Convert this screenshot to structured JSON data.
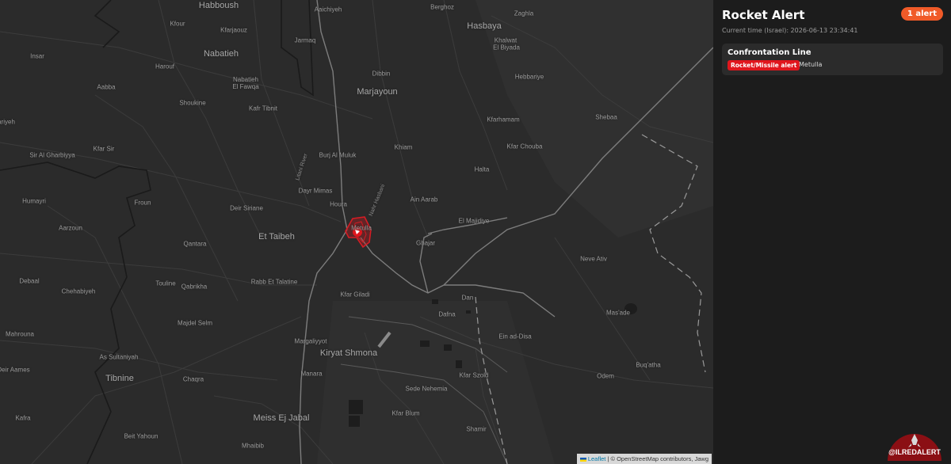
{
  "panel": {
    "title": "Rocket Alert",
    "alert_count": "1 alert",
    "current_time": "Current time (Israel): 2026-06-13 23:34:41",
    "alerts": [
      {
        "region": "Confrontation Line",
        "type": "Rocket/Missile alert",
        "city": "Metulla"
      }
    ],
    "logo_text": "@ILREDALERT"
  },
  "map": {
    "labels": {
      "habboush": "Habboush",
      "aaichiyeh": "Aaichiyeh",
      "berghoz": "Berghoz",
      "zaghla": "Zaghla",
      "hasbaya": "Hasbaya",
      "kfour": "Kfour",
      "kfarjaouz": "Kfarjaouz",
      "jarmaq": "Jarmaq",
      "khalwat": "Khalwat",
      "el_biyada": "El Biyada",
      "insar": "Insar",
      "nabatieh": "Nabatieh",
      "harouf": "Harouf",
      "dibbin": "Dibbin",
      "hebbariye": "Hebbariye",
      "aabba": "Aabba",
      "nabatieh_fawqa": "Nabatieh\nEl Fawqa",
      "marjayoun": "Marjayoun",
      "shoukine": "Shoukine",
      "kafr_tibnit": "Kafr Tibnit",
      "shebaa": "Shebaa",
      "kfarhamam": "Kfarhamam",
      "ariyeh": "ariyeh",
      "kfar_sir": "Kfar Sir",
      "khiam": "Khiam",
      "kfar_chouba": "Kfar Chouba",
      "sir_al_gharbiyya": "Sir Al Gharbiyya",
      "burj_al_muluk": "Burj Al Muluk",
      "halta": "Halta",
      "litani": "Litani River",
      "dayr_mimas": "Dayr Mimas",
      "nahr": "Nahr Hasbani",
      "humayri": "Humayri",
      "froun": "Froun",
      "houra": "Houra",
      "ain_aarab": "Ain Aarab",
      "deir_siriane": "Deir Siriane",
      "el_majidiye": "El Majidiye",
      "aarzoun": "Aarzoun",
      "metulla": "Metulla",
      "et_taibeh": "Et Taibeh",
      "ghajar": "Ghajar",
      "qantara": "Qantara",
      "neve_ativ": "Neve Ativ",
      "debaal": "Debaal",
      "rabb_talatine": "Rabb Et Talatine",
      "touline": "Touline",
      "qabrikha": "Qabrikha",
      "chehabiyeh": "Chehabiyeh",
      "kfar_giladi": "Kfar Giladi",
      "dan": "Dan",
      "masade": "Mas'ade",
      "dafna": "Dafna",
      "majdel_selm": "Majdel Selm",
      "mahrouna": "Mahrouna",
      "margaliyyot": "Margaliyyot",
      "ein_ad_disa": "Ein ad-Disa",
      "as_sultaniyah": "As Sultaniyah",
      "kiryat_shmona": "Kiryat Shmona",
      "deir_aames": "Deir Aames",
      "tibnine": "Tibnine",
      "manara": "Manara",
      "kfar_szold": "Kfar Szold",
      "odem": "Odem",
      "buq_atha": "Buq'atha",
      "chaqra": "Chaqra",
      "sede_nehemia": "Sede Nehemia",
      "kafra": "Kafra",
      "kfar_blum": "Kfar Blum",
      "meiss_ej_jabal": "Meiss Ej Jabal",
      "shamir": "Shamir",
      "beit_yahoun": "Beit Yahoun",
      "mhaibib": "Mhaibib"
    },
    "attribution": {
      "leaflet": "Leaflet",
      "rest": " | © OpenStreetMap contributors, Jawg"
    }
  },
  "colors": {
    "alert_red": "#e0161d",
    "badge_orange": "#f05a28",
    "map_bg": "#2b2b2b",
    "panel_bg": "#1c1c1c"
  }
}
